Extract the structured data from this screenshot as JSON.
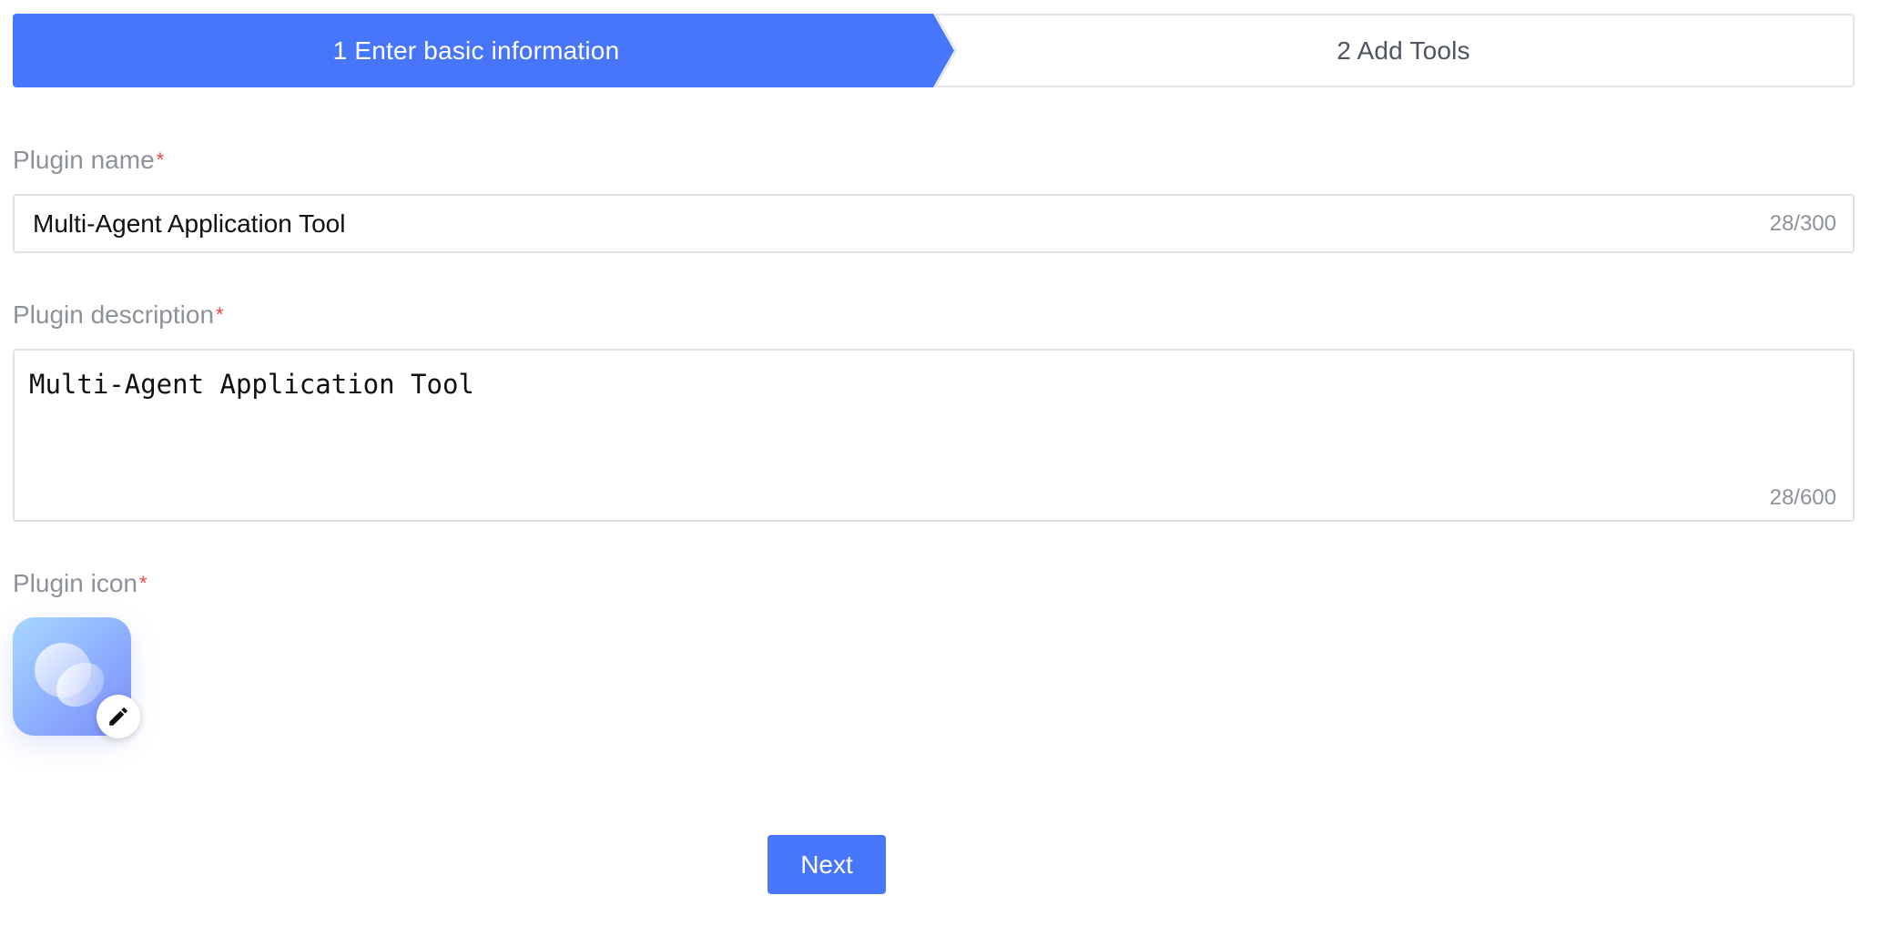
{
  "stepper": {
    "steps": [
      {
        "label": "1 Enter basic information",
        "active": true
      },
      {
        "label": "2 Add Tools",
        "active": false
      }
    ]
  },
  "form": {
    "name": {
      "label": "Plugin name",
      "required_mark": "*",
      "value": "Multi-Agent Application Tool",
      "counter": "28/300"
    },
    "description": {
      "label": "Plugin description",
      "required_mark": "*",
      "value": "Multi-Agent Application Tool",
      "counter": "28/600"
    },
    "icon": {
      "label": "Plugin icon",
      "required_mark": "*",
      "image_icon": "plugin-avatar-icon",
      "edit_icon": "pencil-icon"
    }
  },
  "actions": {
    "next_label": "Next"
  },
  "colors": {
    "primary": "#4876fb",
    "required": "#ef4444",
    "label": "#8c919a",
    "border": "#dfe1e5"
  }
}
